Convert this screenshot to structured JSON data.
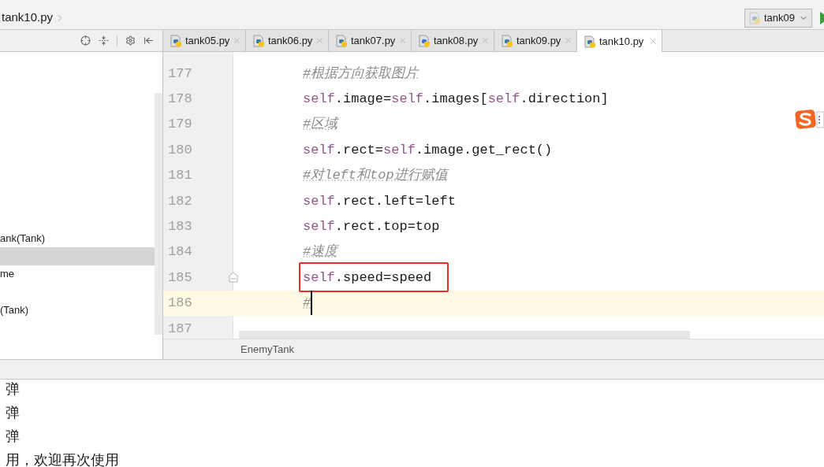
{
  "nav_bar": {
    "breadcrumb": "tank10.py",
    "run_config": {
      "label": "tank09"
    }
  },
  "structure_panel": {
    "items": [
      {
        "label": "ank(Tank)",
        "selected": false
      },
      {
        "selected": true
      },
      {
        "label": "me",
        "selected": false
      },
      {
        "selected": false
      },
      {
        "label": "(Tank)",
        "selected": false
      }
    ]
  },
  "editor": {
    "tabs": [
      {
        "label": "tank05.py",
        "selected": false
      },
      {
        "label": "tank06.py",
        "selected": false
      },
      {
        "label": "tank07.py",
        "selected": false
      },
      {
        "label": "tank08.py",
        "selected": false
      },
      {
        "label": "tank09.py",
        "selected": false
      },
      {
        "label": "tank10.py",
        "selected": true
      }
    ],
    "lines": [
      {
        "number": "177",
        "tokens": [
          {
            "kind": "comment",
            "text": "#根据方向获取图片"
          }
        ],
        "current": false,
        "boxed": false,
        "caret": false,
        "fold": false
      },
      {
        "number": "178",
        "tokens": [
          {
            "kind": "self",
            "text": "self"
          },
          {
            "kind": "plain",
            "text": ".image="
          },
          {
            "kind": "self",
            "text": "self"
          },
          {
            "kind": "plain",
            "text": ".images["
          },
          {
            "kind": "self",
            "text": "self"
          },
          {
            "kind": "plain",
            "text": ".direction]"
          }
        ],
        "current": false,
        "boxed": false,
        "caret": false,
        "fold": false
      },
      {
        "number": "179",
        "tokens": [
          {
            "kind": "comment",
            "text": "#区域"
          }
        ],
        "current": false,
        "boxed": false,
        "caret": false,
        "fold": false
      },
      {
        "number": "180",
        "tokens": [
          {
            "kind": "self",
            "text": "self"
          },
          {
            "kind": "plain",
            "text": ".rect="
          },
          {
            "kind": "self",
            "text": "self"
          },
          {
            "kind": "plain",
            "text": ".image.get_rect()"
          }
        ],
        "current": false,
        "boxed": false,
        "caret": false,
        "fold": false
      },
      {
        "number": "181",
        "tokens": [
          {
            "kind": "comment",
            "text": "#对left和top进行赋值"
          }
        ],
        "current": false,
        "boxed": false,
        "caret": false,
        "fold": false
      },
      {
        "number": "182",
        "tokens": [
          {
            "kind": "self",
            "text": "self"
          },
          {
            "kind": "plain",
            "text": ".rect.left=left"
          }
        ],
        "current": false,
        "boxed": false,
        "caret": false,
        "fold": false
      },
      {
        "number": "183",
        "tokens": [
          {
            "kind": "self",
            "text": "self"
          },
          {
            "kind": "plain",
            "text": ".rect.top=top"
          }
        ],
        "current": false,
        "boxed": false,
        "caret": false,
        "fold": false
      },
      {
        "number": "184",
        "tokens": [
          {
            "kind": "comment",
            "text": "#速度"
          }
        ],
        "current": false,
        "boxed": false,
        "caret": false,
        "fold": false
      },
      {
        "number": "185",
        "tokens": [
          {
            "kind": "self",
            "text": "self"
          },
          {
            "kind": "plain",
            "text": ".speed=speed"
          }
        ],
        "current": false,
        "boxed": true,
        "caret": false,
        "fold": true
      },
      {
        "number": "186",
        "tokens": [
          {
            "kind": "comment",
            "text": "#"
          }
        ],
        "current": true,
        "boxed": false,
        "caret": true,
        "fold": false
      },
      {
        "number": "187",
        "current": false,
        "boxed": false,
        "caret": false,
        "fold": false
      }
    ],
    "breadcrumb": "EnemyTank"
  },
  "console": {
    "lines": [
      "弹",
      "弹",
      "弹",
      "用，欢迎再次使用"
    ]
  }
}
